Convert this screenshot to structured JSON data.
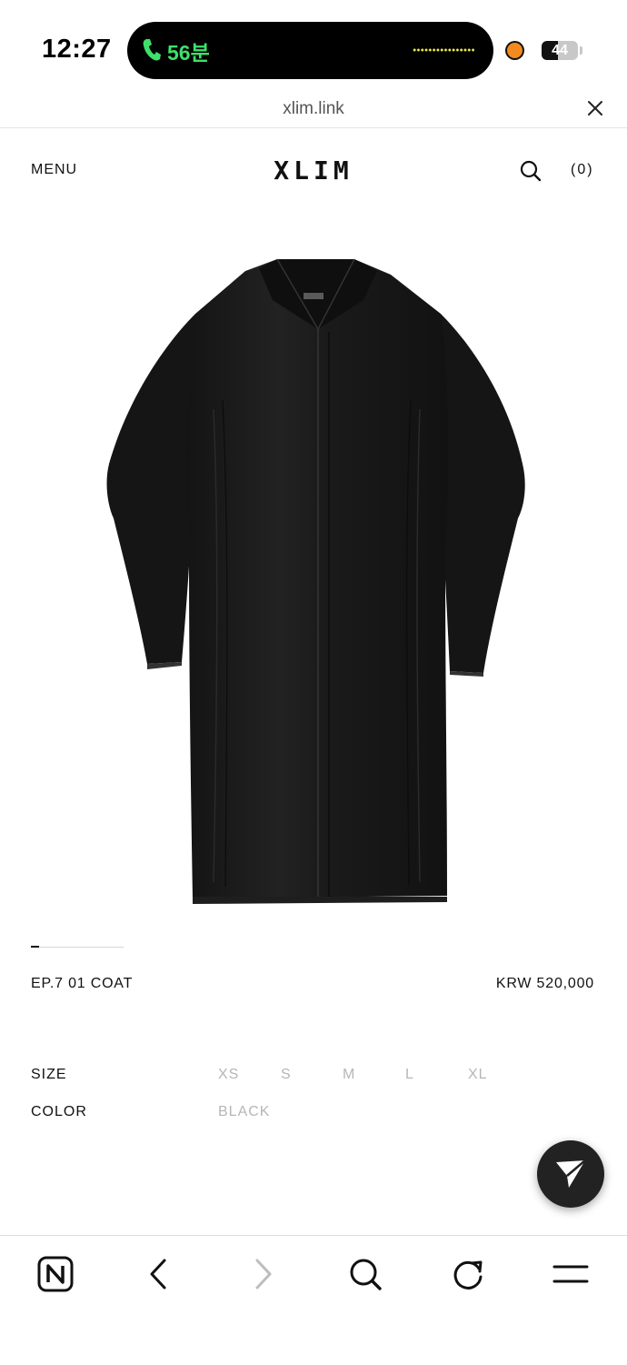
{
  "status_bar": {
    "time": "12:27",
    "call_duration": "56분",
    "battery_level": "44",
    "battery_fraction": 0.44,
    "colors": {
      "call_green": "#3ee06a",
      "recording_orange": "#f28a1d"
    }
  },
  "browser": {
    "url": "xlim.link",
    "icons": [
      "close-icon",
      "naver-home-icon",
      "back-icon",
      "forward-icon",
      "search-icon",
      "reload-icon",
      "menu-icon"
    ]
  },
  "header": {
    "menu_label": "MENU",
    "logo": "XLIM",
    "cart_count": "(0)"
  },
  "product": {
    "name": "EP.7 01 COAT",
    "price": "KRW 520,000",
    "image": "black long shirt coat with raw frayed hems",
    "carousel_position": 1
  },
  "options": {
    "size_label": "SIZE",
    "sizes": [
      "XS",
      "S",
      "M",
      "L",
      "XL"
    ],
    "color_label": "COLOR",
    "colors": [
      "BLACK"
    ]
  },
  "fab": {
    "icon": "send-icon"
  }
}
